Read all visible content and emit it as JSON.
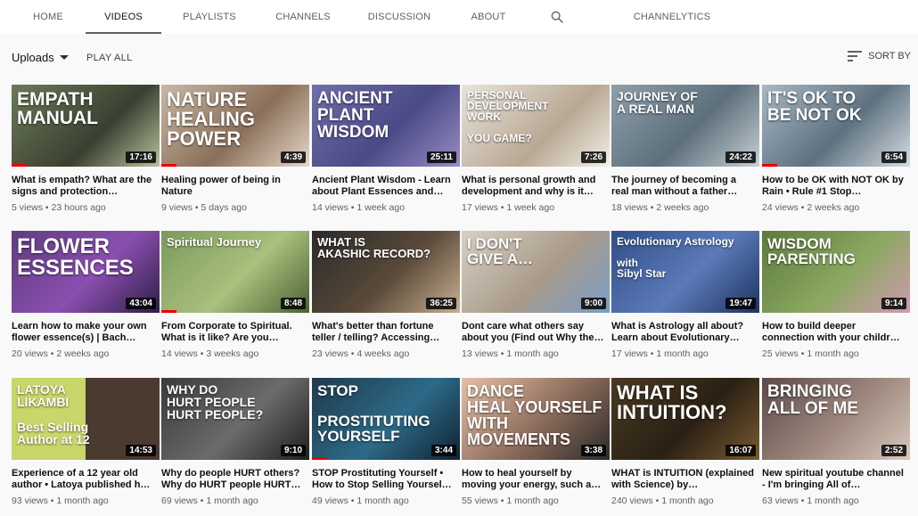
{
  "tabs": [
    {
      "label": "HOME"
    },
    {
      "label": "VIDEOS"
    },
    {
      "label": "PLAYLISTS"
    },
    {
      "label": "CHANNELS"
    },
    {
      "label": "DISCUSSION"
    },
    {
      "label": "ABOUT"
    },
    {
      "label": "CHANNELYTICS"
    }
  ],
  "toolbar": {
    "uploads_label": "Uploads",
    "play_all_label": "PLAY ALL",
    "sort_label": "SORT BY"
  },
  "videos": [
    {
      "thumb_text": "EMPATH\nMANUAL",
      "title": "What is empath? What are the signs and protection…",
      "duration": "17:16",
      "views": "5 views",
      "age": "23 hours ago",
      "watched": 0.1
    },
    {
      "thumb_text": "NATURE\nHEALING POWER",
      "title": "Healing power of being in Nature",
      "duration": "4:39",
      "views": "9 views",
      "age": "5 days ago",
      "watched": 0.1
    },
    {
      "thumb_text": "ANCIENT\nPLANT\nWISDOM",
      "title": "Ancient Plant Wisdom - Learn about Plant Essences and…",
      "duration": "25:11",
      "views": "14 views",
      "age": "1 week ago",
      "watched": 0
    },
    {
      "thumb_text": "PERSONAL\nDEVELOPMENT\nWORK\n\nYOU GAME?",
      "title": "What is personal growth and development and why is it…",
      "duration": "7:26",
      "views": "17 views",
      "age": "1 week ago",
      "watched": 0
    },
    {
      "thumb_text": "JOURNEY OF\nA REAL MAN",
      "title": "The journey of becoming a real man without a father…",
      "duration": "24:22",
      "views": "18 views",
      "age": "2 weeks ago",
      "watched": 0
    },
    {
      "thumb_text": "IT'S OK TO\nBE NOT OK",
      "title": "How to be OK with NOT OK by Rain • Rule #1 Stop…",
      "duration": "6:54",
      "views": "24 views",
      "age": "2 weeks ago",
      "watched": 0.1
    },
    {
      "thumb_text": "FLOWER\nESSENCES",
      "title": "Learn how to make your own flower essence(s) | Bach…",
      "duration": "43:04",
      "views": "20 views",
      "age": "2 weeks ago",
      "watched": 0
    },
    {
      "thumb_text": "Spiritual Journey",
      "title": "From Corporate to Spiritual. What is it like? Are you…",
      "duration": "8:48",
      "views": "14 views",
      "age": "3 weeks ago",
      "watched": 0.1
    },
    {
      "thumb_text": "WHAT IS\nAKASHIC RECORD?",
      "title": "What's better than fortune teller / telling? Accessing…",
      "duration": "36:25",
      "views": "23 views",
      "age": "4 weeks ago",
      "watched": 0
    },
    {
      "thumb_text": "I DON'T\nGIVE A…",
      "title": "Dont care what others say about you (Find out Why the…",
      "duration": "9:00",
      "views": "13 views",
      "age": "1 month ago",
      "watched": 0
    },
    {
      "thumb_text": "Evolutionary Astrology\n\nwith\nSibyl Star",
      "title": "What is Astrology all about? Learn about Evolutionary…",
      "duration": "19:47",
      "views": "17 views",
      "age": "1 month ago",
      "watched": 0
    },
    {
      "thumb_text": "WISDOM\nPARENTING",
      "title": "How to build deeper connection with your childr…",
      "duration": "9:14",
      "views": "25 views",
      "age": "1 month ago",
      "watched": 0
    },
    {
      "thumb_text": "LATOYA\nLIKAMBI\n\nBest Selling\nAuthor at 12",
      "title": "Experience of a 12 year old author • Latoya published h…",
      "duration": "14:53",
      "views": "93 views",
      "age": "1 month ago",
      "watched": 0
    },
    {
      "thumb_text": "WHY DO\nHURT PEOPLE\nHURT PEOPLE?",
      "title": "Why do people HURT others? Why do HURT people HURT…",
      "duration": "9:10",
      "views": "69 views",
      "age": "1 month ago",
      "watched": 0
    },
    {
      "thumb_text": "STOP\n\nPROSTITUTING\nYOURSELF",
      "title": "STOP Prostituting Yourself • How to Stop Selling Yoursel…",
      "duration": "3:44",
      "views": "49 views",
      "age": "1 month ago",
      "watched": 0.1
    },
    {
      "thumb_text": "DANCE\nHEAL YOURSELF\nWITH MOVEMENTS",
      "title": "How to heal yourself by moving your energy, such a…",
      "duration": "3:38",
      "views": "55 views",
      "age": "1 month ago",
      "watched": 0
    },
    {
      "thumb_text": "WHAT IS\nINTUITION?",
      "title": "WHAT is INTUITION (explained with Science) by…",
      "duration": "16:07",
      "views": "240 views",
      "age": "1 month ago",
      "watched": 0
    },
    {
      "thumb_text": "BRINGING\nALL OF ME",
      "title": "New spiritual youtube channel - I'm bringing All of…",
      "duration": "2:52",
      "views": "63 views",
      "age": "1 month ago",
      "watched": 0
    }
  ]
}
